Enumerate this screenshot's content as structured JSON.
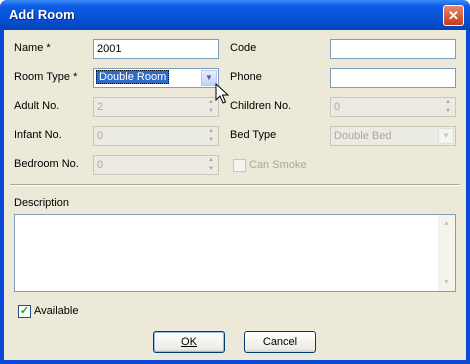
{
  "window": {
    "title": "Add Room",
    "close_glyph": "✕"
  },
  "form": {
    "name_label": "Name *",
    "name_value": "2001",
    "code_label": "Code",
    "code_value": "",
    "room_type_label": "Room Type *",
    "room_type_value": "Double Room",
    "phone_label": "Phone",
    "phone_value": "",
    "adult_label": "Adult No.",
    "adult_value": "2",
    "children_label": "Children No.",
    "children_value": "0",
    "infant_label": "Infant No.",
    "infant_value": "0",
    "bed_type_label": "Bed Type",
    "bed_type_value": "Double Bed",
    "bedroom_label": "Bedroom No.",
    "bedroom_value": "0",
    "can_smoke_label": "Can Smoke",
    "can_smoke_checked": false,
    "description_label": "Description",
    "description_value": "",
    "available_label": "Available",
    "available_checked": true
  },
  "buttons": {
    "ok_label": "OK",
    "cancel_label": "Cancel"
  },
  "icons": {
    "dropdown": "chevron-down-icon",
    "spin_up": "spin-up-icon",
    "spin_down": "spin-down-icon",
    "checkmark": "checkmark-icon"
  }
}
